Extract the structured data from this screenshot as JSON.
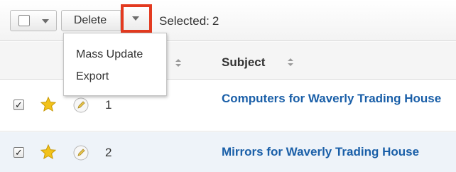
{
  "toolbar": {
    "delete_label": "Delete",
    "selected_label": "Selected:",
    "selected_count": "2"
  },
  "dropdown_menu": {
    "items": [
      "Mass Update",
      "Export"
    ]
  },
  "table": {
    "columns": {
      "subject": "Subject"
    },
    "rows": [
      {
        "number": "1",
        "checked": true,
        "subject": "Computers for Waverly Trading House"
      },
      {
        "number": "2",
        "checked": true,
        "subject": "Mirrors for Waverly Trading House"
      }
    ]
  },
  "colors": {
    "link": "#1a5fa8",
    "highlight_border": "#e33a20",
    "star": "#f2c21a",
    "row_alt": "#eef3f9"
  },
  "icons": [
    "checkbox-icon",
    "chevron-down-icon",
    "favorite-star-icon",
    "edit-pencil-icon",
    "sort-icon"
  ]
}
